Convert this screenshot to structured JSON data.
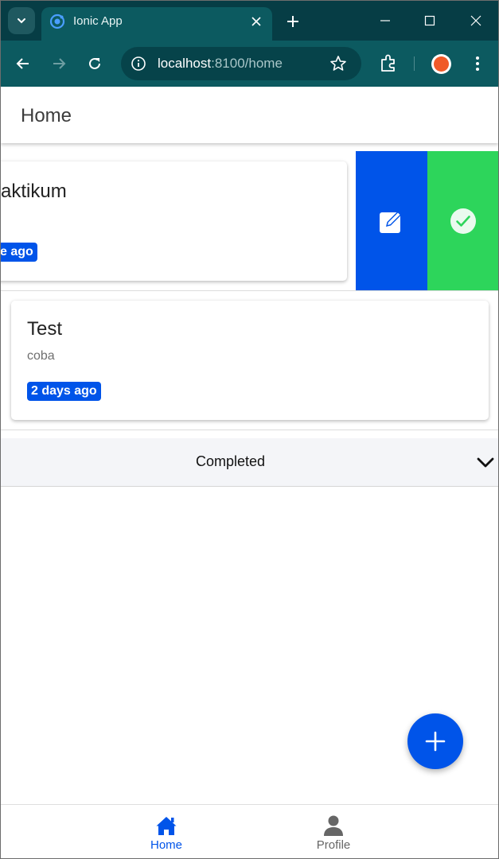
{
  "browser": {
    "tab_title": "Ionic App",
    "url_host": "localhost",
    "url_path": ":8100/home"
  },
  "app": {
    "header_title": "Home",
    "tasks": [
      {
        "title": "Praktikum",
        "visible_title": "aktikum",
        "badge": "ago",
        "visible_badge": "e ago",
        "swiped_open": true
      },
      {
        "title": "Test",
        "description": "coba",
        "badge": "2 days ago",
        "swiped_open": false
      }
    ],
    "swipe_options": [
      {
        "name": "edit",
        "icon": "edit-icon",
        "color": "#0054e9"
      },
      {
        "name": "complete",
        "icon": "checkmark-circle-icon",
        "color": "#2dd55b"
      }
    ],
    "accordion": {
      "label": "Completed",
      "icon": "chevron-down-icon"
    },
    "fab": {
      "icon": "add-icon",
      "color": "#0054e9"
    },
    "tabs": [
      {
        "label": "Home",
        "icon": "home-icon",
        "selected": true
      },
      {
        "label": "Profile",
        "icon": "person-icon",
        "selected": false
      }
    ]
  },
  "colors": {
    "primary": "#0054e9",
    "success": "#2dd55b",
    "chrome_dark": "#063d45",
    "chrome_toolbar": "#0c5a60",
    "tab_inactive": "#666666"
  }
}
